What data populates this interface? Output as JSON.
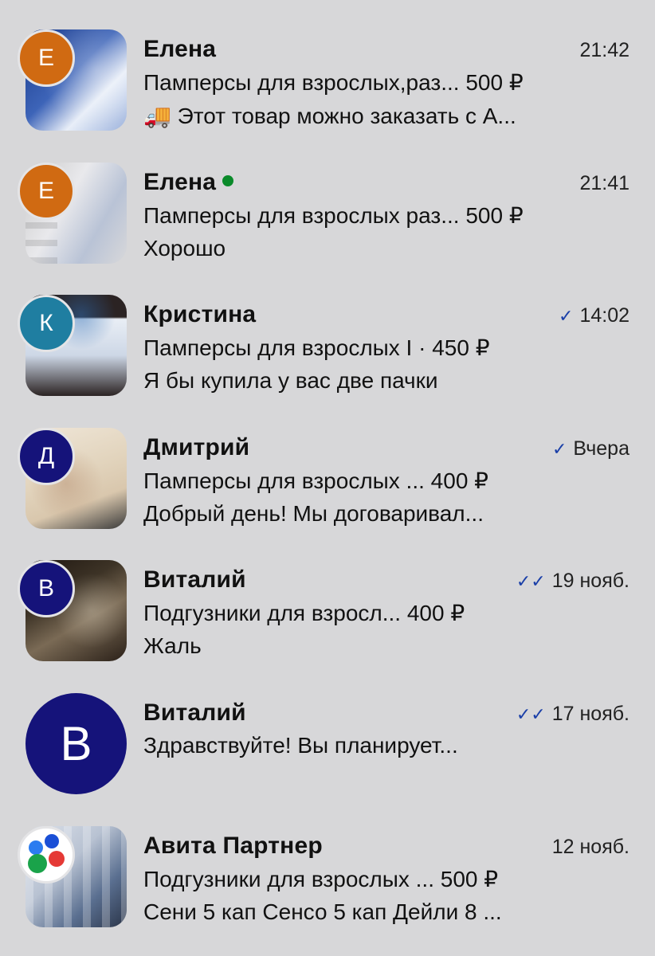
{
  "chats": [
    {
      "name": "Елена",
      "online": false,
      "time": "21:42",
      "check": "",
      "initial": "Е",
      "avatar_color": "#d06a12",
      "item": "Памперсы для взрослых,раз... 500 ₽",
      "message": "🚚 Этот товар можно заказать с А...",
      "thumb_colors": [
        "#1a3a8a",
        "#e8eef8",
        "#4a6fc0"
      ]
    },
    {
      "name": "Елена",
      "online": true,
      "time": "21:41",
      "check": "",
      "initial": "Е",
      "avatar_color": "#d06a12",
      "item": "Памперсы для взрослых раз...  500 ₽",
      "message": "Хорошо",
      "thumb_colors": [
        "#c9c9c9",
        "#e9e9ec",
        "#8aa0c8"
      ]
    },
    {
      "name": "Кристина",
      "online": false,
      "time": "14:02",
      "check": "✓",
      "initial": "К",
      "avatar_color": "#1f7ea1",
      "item": "Памперсы для взрослых I · 450 ₽",
      "message": "Я бы купила у вас две пачки",
      "thumb_colors": [
        "#2b2323",
        "#e9eef5",
        "#2f6db5"
      ]
    },
    {
      "name": "Дмитрий",
      "online": false,
      "time": "Вчера",
      "check": "✓",
      "initial": "Д",
      "avatar_color": "#15137a",
      "item": "Памперсы для взрослых ... 400 ₽",
      "message": "Добрый день! Мы договаривал...",
      "thumb_colors": [
        "#efe6d8",
        "#d9c7ad",
        "#3a3a3a"
      ]
    },
    {
      "name": "Виталий",
      "online": false,
      "time": "19 нояб.",
      "check": "✓✓",
      "initial": "В",
      "avatar_color": "#15137a",
      "item": "Подгузники для взросл... 400 ₽",
      "message": "Жаль",
      "thumb_colors": [
        "#2a2018",
        "#7a6a55",
        "#3d3326"
      ]
    },
    {
      "name": "Виталий",
      "online": false,
      "time": "17 нояб.",
      "check": "✓✓",
      "initial": "В",
      "avatar_color": "#15137a",
      "item": "",
      "message": "Здравствуйте! Вы планирует...",
      "thumb_colors": []
    },
    {
      "name": "Авита Партнер",
      "online": false,
      "time": "12 нояб.",
      "check": "",
      "initial": "",
      "avatar_color": "#ffffff",
      "item": "Подгузники для взрослых ... 500 ₽",
      "message": "Сени 5 кап Сенсо 5 кап Дейли 8 ...",
      "thumb_colors": [
        "#dfe4ec",
        "#5a6f90",
        "#b8c2d2"
      ]
    }
  ]
}
